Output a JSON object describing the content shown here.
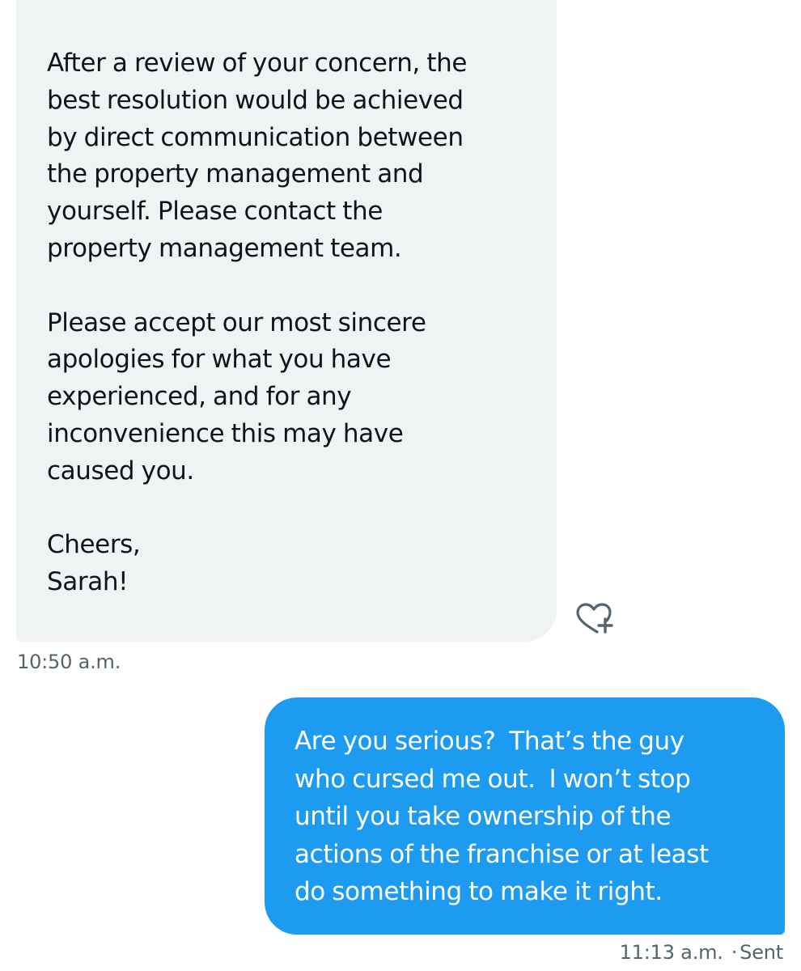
{
  "conversation": {
    "received_message": {
      "paragraphs": [
        [
          "After a review of your concern, the",
          "best resolution would be achieved",
          "by direct communication between",
          "the property management and",
          "yourself. Please contact the",
          "property management team."
        ],
        [
          "Please accept our most sincere",
          "apologies for what you have",
          "experienced, and for any",
          "inconvenience this may have",
          "caused you."
        ],
        [
          "Cheers,",
          "Sarah!"
        ]
      ],
      "timestamp": "10:50 a.m."
    },
    "react_icon": "heart-plus-icon",
    "sent_message": {
      "lines": [
        "Are you serious?  That’s the guy",
        "who cursed me out.  I won’t stop",
        "until you take ownership of the",
        "actions of the franchise or at least",
        "do something to make it right."
      ],
      "timestamp": "11:13 a.m.",
      "separator": "·",
      "status": "Sent"
    }
  },
  "colors": {
    "received_bubble": "#eff3f4",
    "sent_bubble": "#1d9bf0",
    "meta_text": "#536471",
    "body_text": "#0f1419"
  }
}
